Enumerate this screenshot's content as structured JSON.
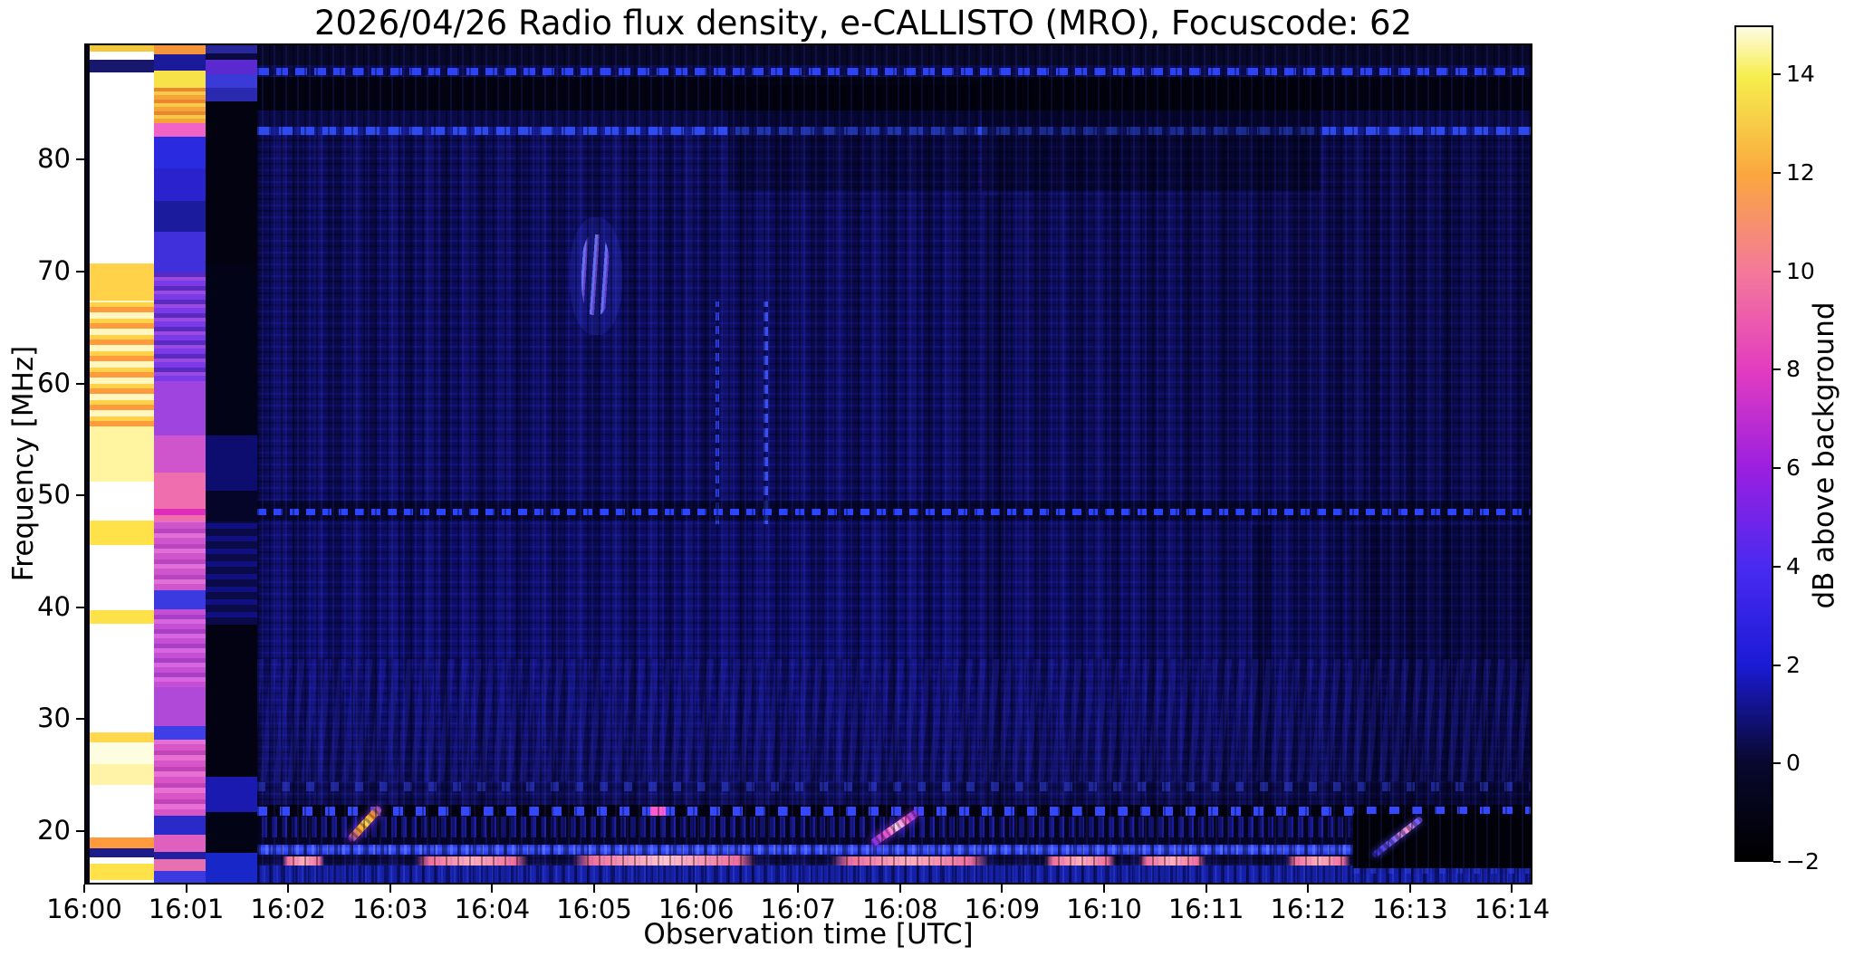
{
  "figure": {
    "title": "2026/04/26  Radio flux density, e-CALLISTO (MRO), Focuscode: 62",
    "background_color": "#ffffff",
    "text_color": "#000000"
  },
  "chart_data": {
    "type": "heatmap",
    "title": "2026/04/26  Radio flux density, e-CALLISTO (MRO), Focuscode: 62",
    "xlabel": "Observation time [UTC]",
    "ylabel": "Frequency [MHz]",
    "grid": false,
    "x_range_minutes": [
      0,
      14.2
    ],
    "x_start_label": "16:00",
    "y_range_mhz": [
      15.2,
      90.4
    ],
    "field_start_minute": 1.679,
    "x_ticks": [
      {
        "t": 0,
        "label": "16:00"
      },
      {
        "t": 1,
        "label": "16:01"
      },
      {
        "t": 2,
        "label": "16:02"
      },
      {
        "t": 3,
        "label": "16:03"
      },
      {
        "t": 4,
        "label": "16:04"
      },
      {
        "t": 5,
        "label": "16:05"
      },
      {
        "t": 6,
        "label": "16:06"
      },
      {
        "t": 7,
        "label": "16:07"
      },
      {
        "t": 8,
        "label": "16:08"
      },
      {
        "t": 9,
        "label": "16:09"
      },
      {
        "t": 10,
        "label": "16:10"
      },
      {
        "t": 11,
        "label": "16:11"
      },
      {
        "t": 12,
        "label": "16:12"
      },
      {
        "t": 13,
        "label": "16:13"
      },
      {
        "t": 14,
        "label": "16:14"
      }
    ],
    "y_ticks": [
      {
        "f": 20,
        "label": "20"
      },
      {
        "f": 30,
        "label": "30"
      },
      {
        "f": 40,
        "label": "40"
      },
      {
        "f": 50,
        "label": "50"
      },
      {
        "f": 60,
        "label": "60"
      },
      {
        "f": 70,
        "label": "70"
      },
      {
        "f": 80,
        "label": "80"
      }
    ],
    "colorbar": {
      "label": "dB above background",
      "range": [
        -2,
        15
      ],
      "ticks": [
        {
          "v": -2,
          "label": "−2"
        },
        {
          "v": 0,
          "label": "0"
        },
        {
          "v": 2,
          "label": "2"
        },
        {
          "v": 4,
          "label": "4"
        },
        {
          "v": 6,
          "label": "6"
        },
        {
          "v": 8,
          "label": "8"
        },
        {
          "v": 10,
          "label": "10"
        },
        {
          "v": 12,
          "label": "12"
        },
        {
          "v": 14,
          "label": "14"
        }
      ],
      "stops": [
        [
          -2,
          "#000000"
        ],
        [
          0,
          "#08082e"
        ],
        [
          2,
          "#1b1bd6"
        ],
        [
          4,
          "#4a2af0"
        ],
        [
          6,
          "#9b1fe0"
        ],
        [
          8,
          "#e23cc0"
        ],
        [
          10,
          "#f4799b"
        ],
        [
          12,
          "#faa73e"
        ],
        [
          14,
          "#f6ee4e"
        ],
        [
          15,
          "#fdfce2"
        ]
      ]
    },
    "calibration_columns": [
      {
        "name": "col-gap",
        "t0": 0,
        "t1": 0.036,
        "bands": [
          [
            90.4,
            15.2,
            "#05051a"
          ]
        ]
      },
      {
        "name": "col-saturated-white",
        "t0": 0.036,
        "t1": 0.666,
        "bands": [
          [
            90.4,
            89.8,
            "#f2c93c"
          ],
          [
            89.8,
            89.1,
            "#ffffff"
          ],
          [
            89.1,
            88.0,
            "#17176e"
          ],
          [
            88.0,
            70.9,
            "#ffffff"
          ],
          [
            70.9,
            67.6,
            "#ffd24a"
          ],
          [
            67.6,
            56.3,
            "repeating-linear-gradient(0deg,#ff9a3d 0 6px,#ffd24a 6px 11px,#fff6c0 11px 18px)"
          ],
          [
            56.3,
            51.4,
            "#fff4a0"
          ],
          [
            51.4,
            47.9,
            "#ffffff"
          ],
          [
            47.9,
            45.7,
            "#ffe24a"
          ],
          [
            45.7,
            39.9,
            "#ffffff"
          ],
          [
            39.9,
            38.7,
            "#ffe24a"
          ],
          [
            38.7,
            29.0,
            "#ffffff"
          ],
          [
            29.0,
            28.1,
            "#ffd84e"
          ],
          [
            28.1,
            26.1,
            "#fffde0"
          ],
          [
            26.1,
            24.3,
            "#fff3a8"
          ],
          [
            24.3,
            19.6,
            "#ffffff"
          ],
          [
            19.6,
            18.6,
            "#ff9a3d"
          ],
          [
            18.6,
            17.8,
            "#1b1b8a"
          ],
          [
            17.8,
            17.2,
            "#ffffff"
          ],
          [
            17.2,
            15.8,
            "#ffe24a"
          ],
          [
            15.8,
            15.2,
            "#ffffff"
          ]
        ]
      },
      {
        "name": "col-pink-attenuated",
        "t0": 0.666,
        "t1": 1.172,
        "bands": [
          [
            90.4,
            89.6,
            "#f5953a"
          ],
          [
            89.6,
            88.1,
            "#1a1a9a"
          ],
          [
            88.1,
            86.6,
            "#f7e24a"
          ],
          [
            86.6,
            83.4,
            "repeating-linear-gradient(0deg,#f5a43a 0 5px,#f7c84a 5px 9px,#e8872e 9px 13px)"
          ],
          [
            83.4,
            82.2,
            "#f263c8"
          ],
          [
            82.2,
            79.4,
            "#2a2ae0"
          ],
          [
            79.4,
            76.5,
            "#2a22cc"
          ],
          [
            76.5,
            73.7,
            "#1b1b9e"
          ],
          [
            73.7,
            70.1,
            "#4030dc"
          ],
          [
            70.1,
            60.4,
            "repeating-linear-gradient(0deg,#7a3ae8 0 6px,#9a4ae0 6px 10px,#5a2ac0 10px 15px)"
          ],
          [
            60.4,
            55.5,
            "#a044e0"
          ],
          [
            55.5,
            52.2,
            "#cf55cc"
          ],
          [
            52.2,
            48.95,
            "#ef6fae"
          ],
          [
            48.95,
            48.35,
            "#e02cb8"
          ],
          [
            48.35,
            47.8,
            "#ef6fae"
          ],
          [
            47.8,
            41.7,
            "repeating-linear-gradient(0deg,#cf55cc 0 7px,#e070d8 7px 12px,#b844c0 12px 17px)"
          ],
          [
            41.7,
            40.0,
            "#3a3ae0"
          ],
          [
            40.0,
            33.0,
            "repeating-linear-gradient(0deg,#c44fd4 0 6px,#d866e0 6px 11px,#a83ec4 11px 16px)"
          ],
          [
            33.0,
            29.5,
            "#b048d8"
          ],
          [
            29.5,
            28.3,
            "#3f3fe8"
          ],
          [
            28.3,
            21.5,
            "repeating-linear-gradient(0deg,#d855c8 0 7px,#e86fd4 7px 13px,#c044b8 13px 18px)"
          ],
          [
            21.5,
            19.8,
            "#2a2ac8"
          ],
          [
            19.8,
            18.3,
            "#e060c0"
          ],
          [
            18.3,
            17.6,
            "#2020a0"
          ],
          [
            17.6,
            16.6,
            "#e86fb0"
          ],
          [
            16.6,
            15.2,
            "#3a3ae0"
          ]
        ]
      },
      {
        "name": "col-dark-attenuated",
        "t0": 1.172,
        "t1": 1.679,
        "bands": [
          [
            90.4,
            89.7,
            "#27279a"
          ],
          [
            89.7,
            89.1,
            "#0a0a40"
          ],
          [
            89.1,
            87.8,
            "#5a2ad0"
          ],
          [
            87.8,
            86.6,
            "#3a3ad8"
          ],
          [
            86.6,
            85.4,
            "#2a2ab0"
          ],
          [
            85.4,
            70.9,
            "#020210"
          ],
          [
            70.9,
            55.5,
            "#030318"
          ],
          [
            55.5,
            50.6,
            "#0d0d70"
          ],
          [
            50.6,
            47.8,
            "#05052a"
          ],
          [
            47.8,
            38.6,
            "repeating-linear-gradient(0deg,#0a0a48 0 8px,#101080 8px 14px)"
          ],
          [
            38.6,
            25.0,
            "#020212"
          ],
          [
            25.0,
            21.8,
            "#1a1ab0"
          ],
          [
            21.8,
            18.2,
            "#030316"
          ],
          [
            18.2,
            15.2,
            "#1828c8"
          ]
        ]
      }
    ],
    "features": [
      {
        "n": "band-top-dark",
        "f0": 88.6,
        "f1": 90.4,
        "bg": "#070728"
      },
      {
        "n": "band-88-base",
        "f0": 87.7,
        "f1": 88.6,
        "bg": "#0c0c50"
      },
      {
        "n": "line-88mhz-dashed",
        "f0": 87.75,
        "f1": 88.35,
        "bg": "repeating-linear-gradient(90deg,#2c42f5 0 13px,rgba(8,8,60,.25) 13px 21px)"
      },
      {
        "n": "band-86-dark",
        "f0": 84.6,
        "f1": 87.6,
        "bg": "#020211"
      },
      {
        "n": "band-84",
        "f0": 83.1,
        "f1": 84.6,
        "bg": "#0a0a46"
      },
      {
        "n": "line-83mhz",
        "f0": 82.4,
        "f1": 83.1,
        "bg": "repeating-linear-gradient(90deg,rgba(50,80,255,.9) 0 15px,rgba(20,30,150,.85) 15px 24px)"
      },
      {
        "n": "shade-upper-a",
        "t0": 6.3,
        "t1": 8.75,
        "f0": 77.4,
        "f1": 86.8,
        "bg": "rgba(0,0,6,.30)"
      },
      {
        "n": "shade-upper-b",
        "t0": 8.78,
        "t1": 12.1,
        "f0": 77.4,
        "f1": 87.3,
        "bg": "rgba(0,0,6,.42)"
      },
      {
        "n": "shade-vband-1",
        "t0": 8.81,
        "t1": 8.97,
        "f0": 22.0,
        "f1": 77.0,
        "bg": "rgba(0,0,6,.26)"
      },
      {
        "n": "shade-vband-2",
        "t0": 11.43,
        "t1": 11.62,
        "f0": 22.0,
        "f1": 47.5,
        "bg": "rgba(0,0,6,.26)"
      },
      {
        "n": "shade-right",
        "t0": 12.4,
        "t1": 14.2,
        "f0": 21.8,
        "f1": 47.5,
        "bg": "rgba(0,0,6,.22)"
      },
      {
        "n": "moire-low-band",
        "f0": 24.6,
        "f1": 35.5,
        "bg": "repeating-linear-gradient(95deg,rgba(40,40,190,.28) 0 7px,rgba(0,0,0,0) 7px 15px),repeating-linear-gradient(85deg,rgba(8,8,50,.32) 0 9px,rgba(0,0,0,0) 9px 19px)"
      },
      {
        "n": "burst-1605-glow",
        "t0": 4.74,
        "t1": 5.26,
        "f0": 64.5,
        "f1": 75.0,
        "bg": "rgba(45,55,210,.28)",
        "rad": "45%"
      },
      {
        "n": "burst-1605-patch",
        "t0": 4.86,
        "t1": 5.13,
        "f0": 66.3,
        "f1": 73.5,
        "bg": "repeating-linear-gradient(94deg,rgba(90,110,255,0) 0 3px,rgba(115,125,255,.85) 3px 6px,rgba(160,95,255,.55) 6px 8px,rgba(20,20,120,0) 8px 12px)",
        "rad": "40%"
      },
      {
        "n": "vline-1606a",
        "t0": 6.17,
        "t1": 6.205,
        "f0": 47.6,
        "f1": 67.5,
        "bg": "repeating-linear-gradient(0deg,#3046f0 0 9px,rgba(0,0,60,.12) 9px 15px)"
      },
      {
        "n": "vline-1606b",
        "t0": 6.645,
        "t1": 6.685,
        "f0": 47.6,
        "f1": 67.5,
        "bg": "repeating-linear-gradient(0deg,#3a50f5 0 10px,rgba(0,0,60,.12) 10px 16px)"
      },
      {
        "n": "band-49-dark",
        "f0": 47.9,
        "f1": 49.7,
        "bg": "rgba(2,2,14,.55)"
      },
      {
        "n": "line-48.8mhz-dashed",
        "f0": 48.35,
        "f1": 48.95,
        "bg": "repeating-linear-gradient(90deg,#2a44ff 0 10px,rgba(4,4,30,.3) 10px 18px)"
      },
      {
        "n": "row-24mhz-dashes",
        "f0": 23.7,
        "f1": 24.5,
        "bg": "repeating-linear-gradient(90deg,rgba(55,75,245,.8) 0 9px,rgba(0,0,18,.18) 9px 27px)",
        "op": 0.55
      },
      {
        "n": "row-22mhz-dark",
        "f0": 21.4,
        "f1": 22.5,
        "bg": "#020210"
      },
      {
        "n": "row-22mhz-dashes",
        "f0": 21.55,
        "f1": 22.3,
        "bg": "repeating-linear-gradient(90deg,#3347ff 0 11px,rgba(2,2,16,.12) 11px 25px)"
      },
      {
        "n": "row-22mhz-pink-dash",
        "t0": 5.53,
        "t1": 5.68,
        "f0": 21.55,
        "f1": 22.3,
        "bg": "#ff5ad0"
      },
      {
        "n": "hatch-20mhz",
        "t0": 1.679,
        "t1": 12.4,
        "f0": 19.5,
        "f1": 21.4,
        "bg": "repeating-linear-gradient(90deg,#05051f 0 5px,#11116e 5px 9px,#1b1b9e 9px 11px)"
      },
      {
        "n": "band-19-dark",
        "f0": 18.95,
        "f1": 19.55,
        "bg": "#05052c"
      },
      {
        "n": "ionosonde-band-18.5mhz",
        "t0": 1.679,
        "t1": 12.42,
        "f0": 18.0,
        "f1": 18.95,
        "bg": "repeating-linear-gradient(90deg,rgba(6,6,40,.5) 0 4px,rgba(0,0,0,0) 4px 9px,rgba(130,150,255,.4) 9px 12px,rgba(0,0,0,0) 12px 17px),linear-gradient(0deg,#2236dd,#4158ff 55%,#2236dd)"
      },
      {
        "n": "bottom-edge-band",
        "f0": 15.2,
        "f1": 17.05,
        "bg": "repeating-linear-gradient(90deg,rgba(0,0,25,.45) 0 3px,rgba(0,0,0,0) 3px 7px,rgba(70,90,255,.25) 7px 9px,rgba(0,0,0,0) 9px 14px),#141fa6"
      },
      {
        "n": "salmon-seg-1",
        "t0": 1.93,
        "t1": 2.34,
        "f0": 17.1,
        "f1": 17.85,
        "bg": "linear-gradient(90deg,rgba(240,110,150,0),#ef6f9a 12%,#ffb0bc 50%,#ef6f9a 88%,rgba(240,110,150,0))"
      },
      {
        "n": "salmon-seg-2",
        "t0": 3.23,
        "t1": 4.33,
        "f0": 17.1,
        "f1": 17.85,
        "bg": "linear-gradient(90deg,rgba(240,110,150,0),#ef6f9a 12%,#ffb0bc 50%,#ef6f9a 88%,rgba(240,110,150,0))"
      },
      {
        "n": "salmon-seg-3",
        "t0": 4.77,
        "t1": 6.57,
        "f0": 17.05,
        "f1": 17.95,
        "bg": "linear-gradient(90deg,rgba(240,110,150,0),#ef6f9a 10%,#ffc3cc 50%,#ef6f9a 90%,rgba(240,110,150,0))"
      },
      {
        "n": "salmon-seg-4",
        "t0": 7.3,
        "t1": 8.85,
        "f0": 17.1,
        "f1": 17.85,
        "bg": "linear-gradient(90deg,rgba(240,110,150,0),#ef6f9a 12%,#ffb0bc 50%,#ef6f9a 88%,rgba(240,110,150,0))"
      },
      {
        "n": "salmon-seg-5",
        "t0": 9.4,
        "t1": 10.1,
        "f0": 17.1,
        "f1": 17.85,
        "bg": "linear-gradient(90deg,rgba(240,110,150,0),#ef6f9a 12%,#ffb0bc 50%,#ef6f9a 88%,rgba(240,110,150,0))"
      },
      {
        "n": "salmon-seg-6",
        "t0": 10.32,
        "t1": 10.98,
        "f0": 17.1,
        "f1": 17.85,
        "bg": "linear-gradient(90deg,rgba(240,110,150,0),#ef6f9a 12%,#ffb0bc 50%,#ef6f9a 88%,rgba(240,110,150,0))"
      },
      {
        "n": "salmon-seg-7",
        "t0": 11.78,
        "t1": 12.4,
        "f0": 17.1,
        "f1": 17.85,
        "bg": "linear-gradient(90deg,rgba(240,110,150,0),#ef6f9a 12%,#ffb0bc 50%,#ef6f9a 88%,rgba(240,110,150,0))"
      },
      {
        "n": "black-box-right",
        "t0": 12.42,
        "t1": 14.2,
        "f0": 16.85,
        "f1": 21.7,
        "bg": "#010107"
      },
      {
        "n": "box-blue-specks",
        "t0": 12.42,
        "t1": 14.2,
        "f0": 16.3,
        "f1": 16.85,
        "bg": "repeating-linear-gradient(90deg,rgba(40,60,220,.8) 0 7px,rgba(0,0,10,.1) 7px 19px)",
        "op": 0.7
      },
      {
        "n": "drift-burst-1603",
        "k": "s",
        "t0": 2.58,
        "f0": 19.3,
        "t1": 2.88,
        "f1": 22.3,
        "h": 9,
        "bg": "repeating-linear-gradient(90deg,rgba(0,0,0,.30) 0 3px,rgba(0,0,0,0) 3px 7px),linear-gradient(90deg,#7a2ae0,#ff9a2e 30%,#ffd84e 55%,#ff9a2e 75%,#8a3ae0)",
        "sh": "0 0 10px rgba(150,60,240,.8)"
      },
      {
        "n": "drift-burst-1608",
        "k": "s",
        "t0": 7.7,
        "f0": 19.0,
        "t1": 8.16,
        "f1": 21.9,
        "h": 9,
        "bg": "repeating-linear-gradient(90deg,rgba(0,0,0,.30) 0 3px,rgba(0,0,0,0) 3px 7px),linear-gradient(90deg,#6a2ae8,#ff5ad0 35%,#ffd9f0 55%,#ff5ad0 75%,#6a2ae8)",
        "sh": "0 0 10px rgba(140,50,240,.8)"
      },
      {
        "n": "drift-streak-1612",
        "k": "s",
        "t0": 12.62,
        "f0": 17.9,
        "t1": 13.1,
        "f1": 21.3,
        "h": 7,
        "bg": "repeating-linear-gradient(90deg,rgba(0,0,0,.35) 0 4px,rgba(0,0,0,0) 4px 8px),linear-gradient(90deg,#2a2ad0,#7a5cff 40%,#ff9ad8 70%,#7a5cff 90%)",
        "sh": "0 0 8px rgba(90,80,255,.7)"
      }
    ]
  }
}
